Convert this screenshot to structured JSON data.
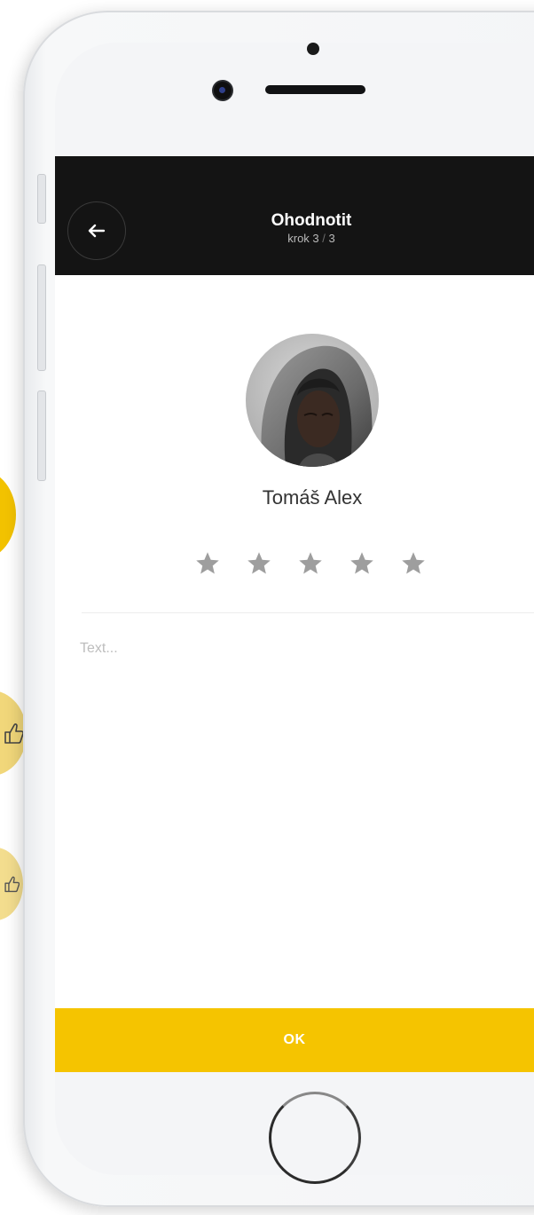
{
  "header": {
    "title": "Ohodnotit",
    "step_prefix": "krok 3",
    "step_separator": "/",
    "step_total": "3"
  },
  "profile": {
    "name": "Tomáš Alex"
  },
  "rating": {
    "stars_total": 5,
    "stars_selected": 0
  },
  "review": {
    "value": "",
    "placeholder": "Text..."
  },
  "actions": {
    "ok_label": "OK"
  },
  "colors": {
    "header_bg": "#141414",
    "accent": "#f5c400",
    "star_inactive": "#9e9e9e"
  },
  "icons": {
    "back": "arrow-left-icon",
    "star": "star-icon",
    "thumbs_up": "thumbs-up-icon"
  }
}
